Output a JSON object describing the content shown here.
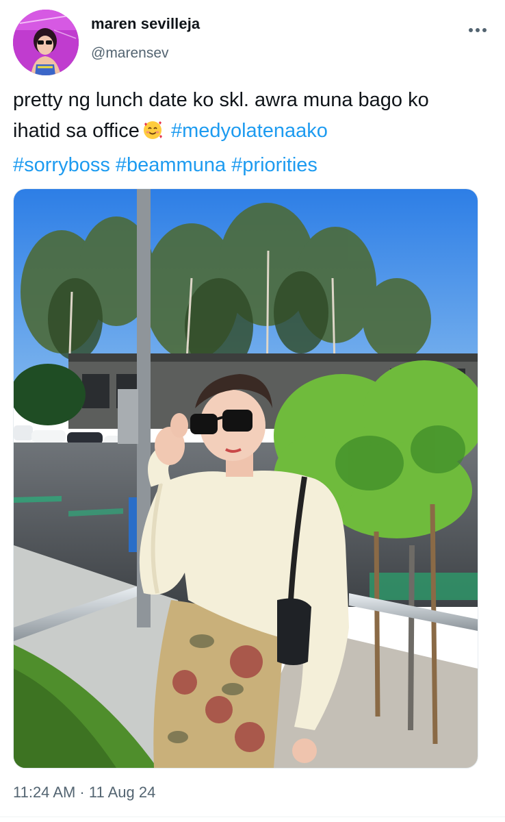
{
  "author": {
    "display_name": "maren sevilleja",
    "handle": "@marensev",
    "avatar_icon": "profile-photo"
  },
  "tweet": {
    "text_line1": "pretty ng lunch date ko skl. awra muna bago ko",
    "text_line2_prefix": "ihatid sa office",
    "emoji_icon": "smiling-face-with-hearts-icon",
    "hashtags": [
      "#medyolatenaako",
      "#sorryboss",
      "#beammuna",
      "#priorities"
    ],
    "timestamp": "11:24 AM · 11 Aug 24"
  },
  "actions": {
    "more_icon": "more-horizontal-icon"
  },
  "colors": {
    "link": "#1d9bf0",
    "secondary_text": "#536471",
    "primary_text": "#0f1419"
  }
}
